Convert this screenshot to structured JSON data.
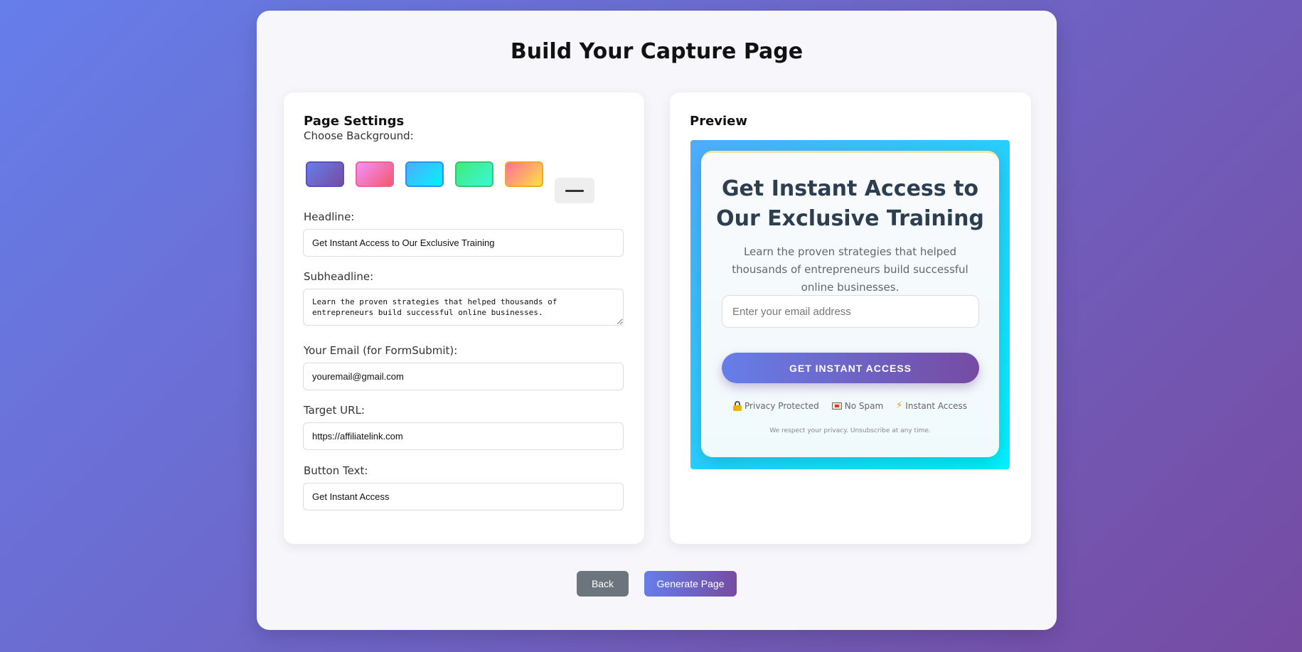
{
  "page": {
    "title": "Build Your Capture Page"
  },
  "settings": {
    "heading": "Page Settings",
    "background_label": "Choose Background:",
    "swatches": [
      {
        "name": "purple",
        "colors": [
          "#667eea",
          "#764ba2"
        ]
      },
      {
        "name": "pink",
        "colors": [
          "#f093fb",
          "#f5576c"
        ]
      },
      {
        "name": "blue",
        "colors": [
          "#4facfe",
          "#00f2fe"
        ]
      },
      {
        "name": "green",
        "colors": [
          "#43e97b",
          "#38f9d7"
        ]
      },
      {
        "name": "orange",
        "colors": [
          "#fa709a",
          "#fee140"
        ]
      }
    ],
    "more_icon": "minus-icon",
    "headline_label": "Headline:",
    "headline_value": "Get Instant Access to Our Exclusive Training",
    "subheadline_label": "Subheadline:",
    "subheadline_value": "Learn the proven strategies that helped thousands of entrepreneurs build successful online businesses.",
    "email_label": "Your Email (for FormSubmit):",
    "email_value": "youremail@gmail.com",
    "url_label": "Target URL:",
    "url_value": "https://affiliatelink.com",
    "button_label": "Button Text:",
    "button_value": "Get Instant Access"
  },
  "preview": {
    "heading": "Preview",
    "headline": "Get Instant Access to Our Exclusive Training",
    "subheadline": "Learn the proven strategies that helped thousands of entrepreneurs build successful online businesses.",
    "email_placeholder": "Enter your email address",
    "button": "Get Instant Access",
    "badges": [
      {
        "icon": "lock-icon",
        "label": "Privacy Protected"
      },
      {
        "icon": "mail-icon",
        "label": "No Spam"
      },
      {
        "icon": "lightning-icon",
        "label": "Instant Access"
      }
    ],
    "privacy": "We respect your privacy. Unsubscribe at any time."
  },
  "actions": {
    "back": "Back",
    "generate": "Generate Page"
  },
  "colors": {
    "accent_start": "#667eea",
    "accent_end": "#764ba2",
    "secondary": "#6c757d"
  }
}
